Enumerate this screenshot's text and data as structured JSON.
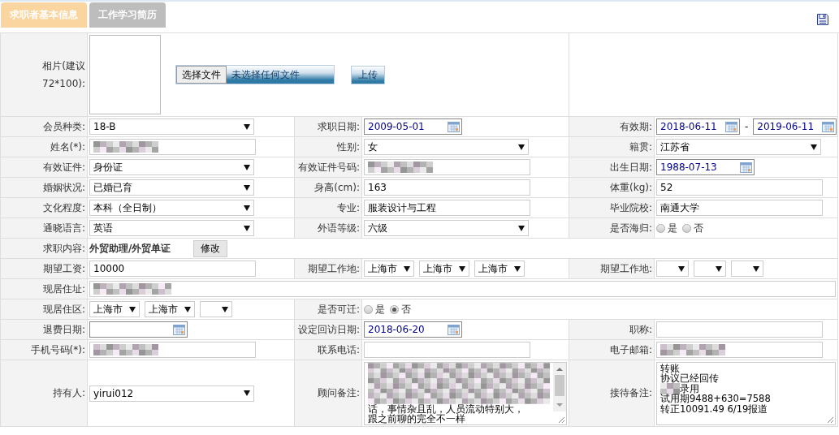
{
  "tabs": [
    {
      "label": "求职者基本信息",
      "selected": true
    },
    {
      "label": "工作学习简历",
      "selected": false
    }
  ],
  "photo": {
    "label": "相片(建议72*100):",
    "choose_button": "选择文件",
    "file_status": "未选择任何文件",
    "upload_button": "上传"
  },
  "rows": [
    [
      {
        "label": "会员种类:",
        "field": {
          "kind": "select",
          "value": "18-B"
        }
      },
      {
        "label": "求职日期:",
        "field": {
          "kind": "date",
          "value": "2009-05-01"
        }
      },
      {
        "label": "有效期:",
        "field": {
          "kind": "date-range",
          "from": "2018-06-11",
          "separator": "-",
          "to": "2019-06-11"
        }
      }
    ],
    [
      {
        "label": "姓名(*):",
        "field": {
          "kind": "text",
          "redacted": true
        }
      },
      {
        "label": "性别:",
        "field": {
          "kind": "select",
          "value": "女"
        }
      },
      {
        "label": "籍贯:",
        "field": {
          "kind": "select",
          "value": "江苏省"
        }
      }
    ],
    [
      {
        "label": "有效证件:",
        "field": {
          "kind": "select",
          "value": "身份证"
        }
      },
      {
        "label": "有效证件号码:",
        "field": {
          "kind": "text",
          "redacted": true
        }
      },
      {
        "label": "出生日期:",
        "field": {
          "kind": "date",
          "value": "1988-07-13"
        }
      }
    ],
    [
      {
        "label": "婚姻状况:",
        "field": {
          "kind": "select",
          "value": "已婚已育"
        }
      },
      {
        "label": "身高(cm):",
        "field": {
          "kind": "text",
          "value": "163"
        }
      },
      {
        "label": "体重(kg):",
        "field": {
          "kind": "text",
          "value": "52"
        }
      }
    ],
    [
      {
        "label": "文化程度:",
        "field": {
          "kind": "select",
          "value": "本科（全日制）"
        }
      },
      {
        "label": "专业:",
        "field": {
          "kind": "text",
          "value": "服装设计与工程"
        }
      },
      {
        "label": "毕业院校:",
        "field": {
          "kind": "text",
          "value": "南通大学"
        }
      }
    ],
    [
      {
        "label": "通晓语言:",
        "field": {
          "kind": "select",
          "value": "英语"
        }
      },
      {
        "label": "外语等级:",
        "field": {
          "kind": "select",
          "value": "六级"
        }
      },
      {
        "label": "是否海归:",
        "field": {
          "kind": "radio",
          "options": [
            {
              "label": "是",
              "selected": false
            },
            {
              "label": "否",
              "selected": false
            }
          ]
        }
      }
    ],
    [
      {
        "label": "求职内容:",
        "field": {
          "kind": "job",
          "value": "外贸助理/外贸单证",
          "button": "修改"
        }
      }
    ],
    [
      {
        "label": "期望工资:",
        "field": {
          "kind": "text",
          "value": "10000"
        }
      },
      {
        "label": "期望工作地:",
        "field": {
          "kind": "select-group",
          "items": [
            {
              "kind": "select",
              "value": "上海市"
            },
            {
              "kind": "select",
              "value": "上海市"
            },
            {
              "kind": "select",
              "value": "上海市"
            }
          ]
        }
      },
      {
        "label": "期望工作地:",
        "field": {
          "kind": "select-group",
          "items": [
            {
              "kind": "select"
            },
            {
              "kind": "select"
            },
            {
              "kind": "select"
            }
          ]
        }
      }
    ],
    [
      {
        "label": "现居住址:",
        "field": {
          "kind": "text",
          "redacted": true
        }
      }
    ],
    [
      {
        "label": "现居住区:",
        "field": {
          "kind": "select-group",
          "items": [
            {
              "kind": "select",
              "value": "上海市"
            },
            {
              "kind": "select",
              "value": "上海市"
            },
            {
              "kind": "select"
            }
          ]
        }
      },
      {
        "label": "是否可迁:",
        "field": {
          "kind": "radio",
          "options": [
            {
              "label": "是",
              "selected": false
            },
            {
              "label": "否",
              "selected": true
            }
          ]
        }
      }
    ],
    [
      {
        "label": "退费日期:",
        "field": {
          "kind": "date"
        }
      },
      {
        "label": "设定回访日期:",
        "field": {
          "kind": "date",
          "value": "2018-06-20"
        }
      },
      {
        "label": "职称:",
        "field": {
          "kind": "text"
        }
      }
    ],
    [
      {
        "label": "手机号码(*):",
        "field": {
          "kind": "text",
          "redacted": true
        }
      },
      {
        "label": "联系电话:",
        "field": {
          "kind": "text"
        }
      },
      {
        "label": "电子邮箱:",
        "field": {
          "kind": "text",
          "redacted": true
        }
      }
    ],
    [
      {
        "label": "持有人:",
        "field": {
          "kind": "select",
          "value": "yirui012"
        }
      },
      {
        "label": "顾问备注:",
        "field": {
          "kind": "textarea",
          "lines": [
            {
              "redacted": true
            },
            {
              "redacted": true
            },
            {
              "redacted": true
            },
            {
              "redacted": true
            },
            {
              "text": "话，事情杂且乱，人员流动特别大，"
            },
            {
              "text": "跟之前聊的完全不一样"
            }
          ]
        }
      },
      {
        "label": "接待备注:",
        "field": {
          "kind": "textarea",
          "lines": [
            {
              "text": "转账"
            },
            {
              "text": "协议已经回传"
            },
            {
              "text": "录用",
              "redacted": true
            },
            {
              "text": "试用期9488+630=7588"
            },
            {
              "text": "转正10091.49  6/19报道"
            }
          ]
        }
      }
    ]
  ]
}
